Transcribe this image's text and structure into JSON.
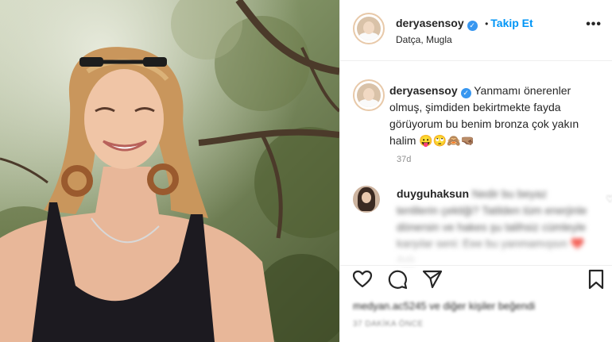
{
  "post": {
    "username": "deryasensoy",
    "follow_label": "Takip Et",
    "separator": "•",
    "location": "Datça, Mugla",
    "more_label": "•••",
    "verified_mark": "✓"
  },
  "caption": {
    "username": "deryasensoy",
    "text": "Yanmamı önerenler olmuş, şimdiden bekirtmekte fayda görüyorum bu benim bronza çok yakın halim 😛🙄🙈🤜🏽",
    "time": "37d"
  },
  "comment": {
    "username": "duyguhaksun",
    "text": "Nedir bu beyaz tenlilerin çektiği? Tatilden tüm enerjinle dönersin ve hakes şu talihsiz cümleyle karşılar seni: Eee bu yanmamışsın ❤️ Aslı",
    "heart_label": "♡"
  },
  "footer": {
    "likes_text": "medyan.ac5245 ve diğer kişiler beğendi",
    "ago_text": "37 DAKİKA ÖNCE"
  },
  "icons": {
    "like": "heart-icon",
    "comment": "comment-icon",
    "share": "share-icon",
    "save": "bookmark-icon"
  },
  "colors": {
    "accent": "#0095f6",
    "verified": "#3897f0",
    "text": "#262626",
    "muted": "#8e8e8e"
  }
}
